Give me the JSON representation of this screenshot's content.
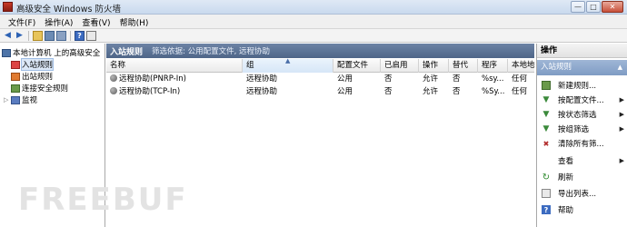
{
  "window": {
    "title": "高级安全 Windows 防火墙",
    "buttons": {
      "minimize": "—",
      "maximize": "□",
      "close": "✕"
    }
  },
  "menu": [
    "文件(F)",
    "操作(A)",
    "查看(V)",
    "帮助(H)"
  ],
  "toolbar": {
    "help_label": "?"
  },
  "tree": {
    "root": "本地计算机 上的高级安全",
    "items": [
      "入站规则",
      "出站规则",
      "连接安全规则",
      "监视"
    ],
    "selected": "入站规则"
  },
  "main": {
    "title": "入站规则",
    "filter": "筛选依据: 公用配置文件, 远程协助",
    "columns": [
      "名称",
      "组",
      "配置文件",
      "已启用",
      "操作",
      "替代",
      "程序",
      "本地地"
    ],
    "sort_indicator": "▲",
    "rows": [
      {
        "name": "远程协助(PNRP-In)",
        "group": "远程协助",
        "profile": "公用",
        "enabled": "否",
        "action": "允许",
        "override": "否",
        "program": "%sy...",
        "local": "任何"
      },
      {
        "name": "远程协助(TCP-In)",
        "group": "远程协助",
        "profile": "公用",
        "enabled": "否",
        "action": "允许",
        "override": "否",
        "program": "%Sy...",
        "local": "任何"
      }
    ]
  },
  "actions": {
    "header": "操作",
    "section": "入站规则",
    "section_caret": "▲",
    "items": [
      "新建规则...",
      "按配置文件...",
      "按状态筛选",
      "按组筛选",
      "清除所有筛...",
      "查看",
      "刷新",
      "导出列表...",
      "帮助"
    ],
    "submenu_arrow": "▶"
  },
  "watermark": "FREEBUF",
  "colors": {
    "header_blue": "#4e6688",
    "action_blue": "#7f9cc4",
    "selection": "#dce8f7"
  }
}
